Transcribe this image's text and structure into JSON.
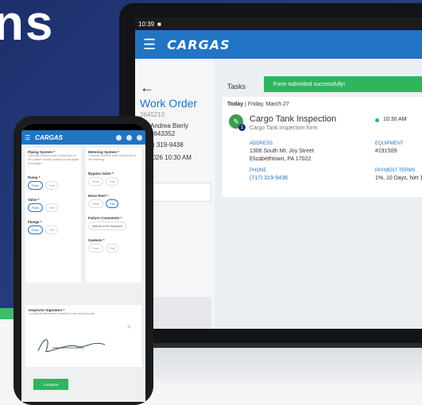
{
  "hero": {
    "word": "ns"
  },
  "laptop": {
    "status_time": "10:39",
    "app_brand": "CARGAS",
    "toast": "Form submitted successfully!",
    "left": {
      "title": "Work Order",
      "number": "2645210",
      "contact_name": "Andrea Bierly",
      "contact_num": "#643352",
      "phone": "(717) 319-9438",
      "date": "27/2026 10:30 AM"
    },
    "tasks_label": "Tasks",
    "today": {
      "bold": "Today",
      "date": "Friday, March 27"
    },
    "task": {
      "title": "Cargo Tank Inspection",
      "subtitle": "Cargo Tank Inspection form",
      "time": "10:30 AM",
      "badge": "1",
      "address_label": "ADDRESS",
      "address_line1": "1306 South Mt. Joy Street",
      "address_line2": "Elizabethtown, PA 17022",
      "phone_label": "PHONE",
      "phone": "(717) 319-9438",
      "equipment_label": "EQUIPMENT",
      "equipment": "#191509",
      "terms_label": "PAYMENT TERMS",
      "terms": "1%, 10 Days, Net 1"
    }
  },
  "phone": {
    "brand": "CARGAS",
    "left_col": {
      "piping_h": "Piping System *",
      "piping_t": "Carefully examine each component of the system visually looking for any signs of leakage",
      "pump_h": "Pump *",
      "valve_h": "Valve *",
      "flange_h": "Flange *",
      "pass": "Pass",
      "fail": "Fail"
    },
    "right_col": {
      "metering_h": "Metering System *",
      "metering_t": "Carefully examine each component of the metering",
      "bypass_h": "Bypass Valve *",
      "hose_h": "Hose Reel *",
      "failure_h": "Failure Comments *",
      "failure_v": "Needs to be replaced",
      "gaskets_h": "Gaskets *"
    },
    "sig_h": "Inspector Signature *",
    "sig_t": "I certify all information recorded is true and accurate",
    "complete": "Complete"
  }
}
